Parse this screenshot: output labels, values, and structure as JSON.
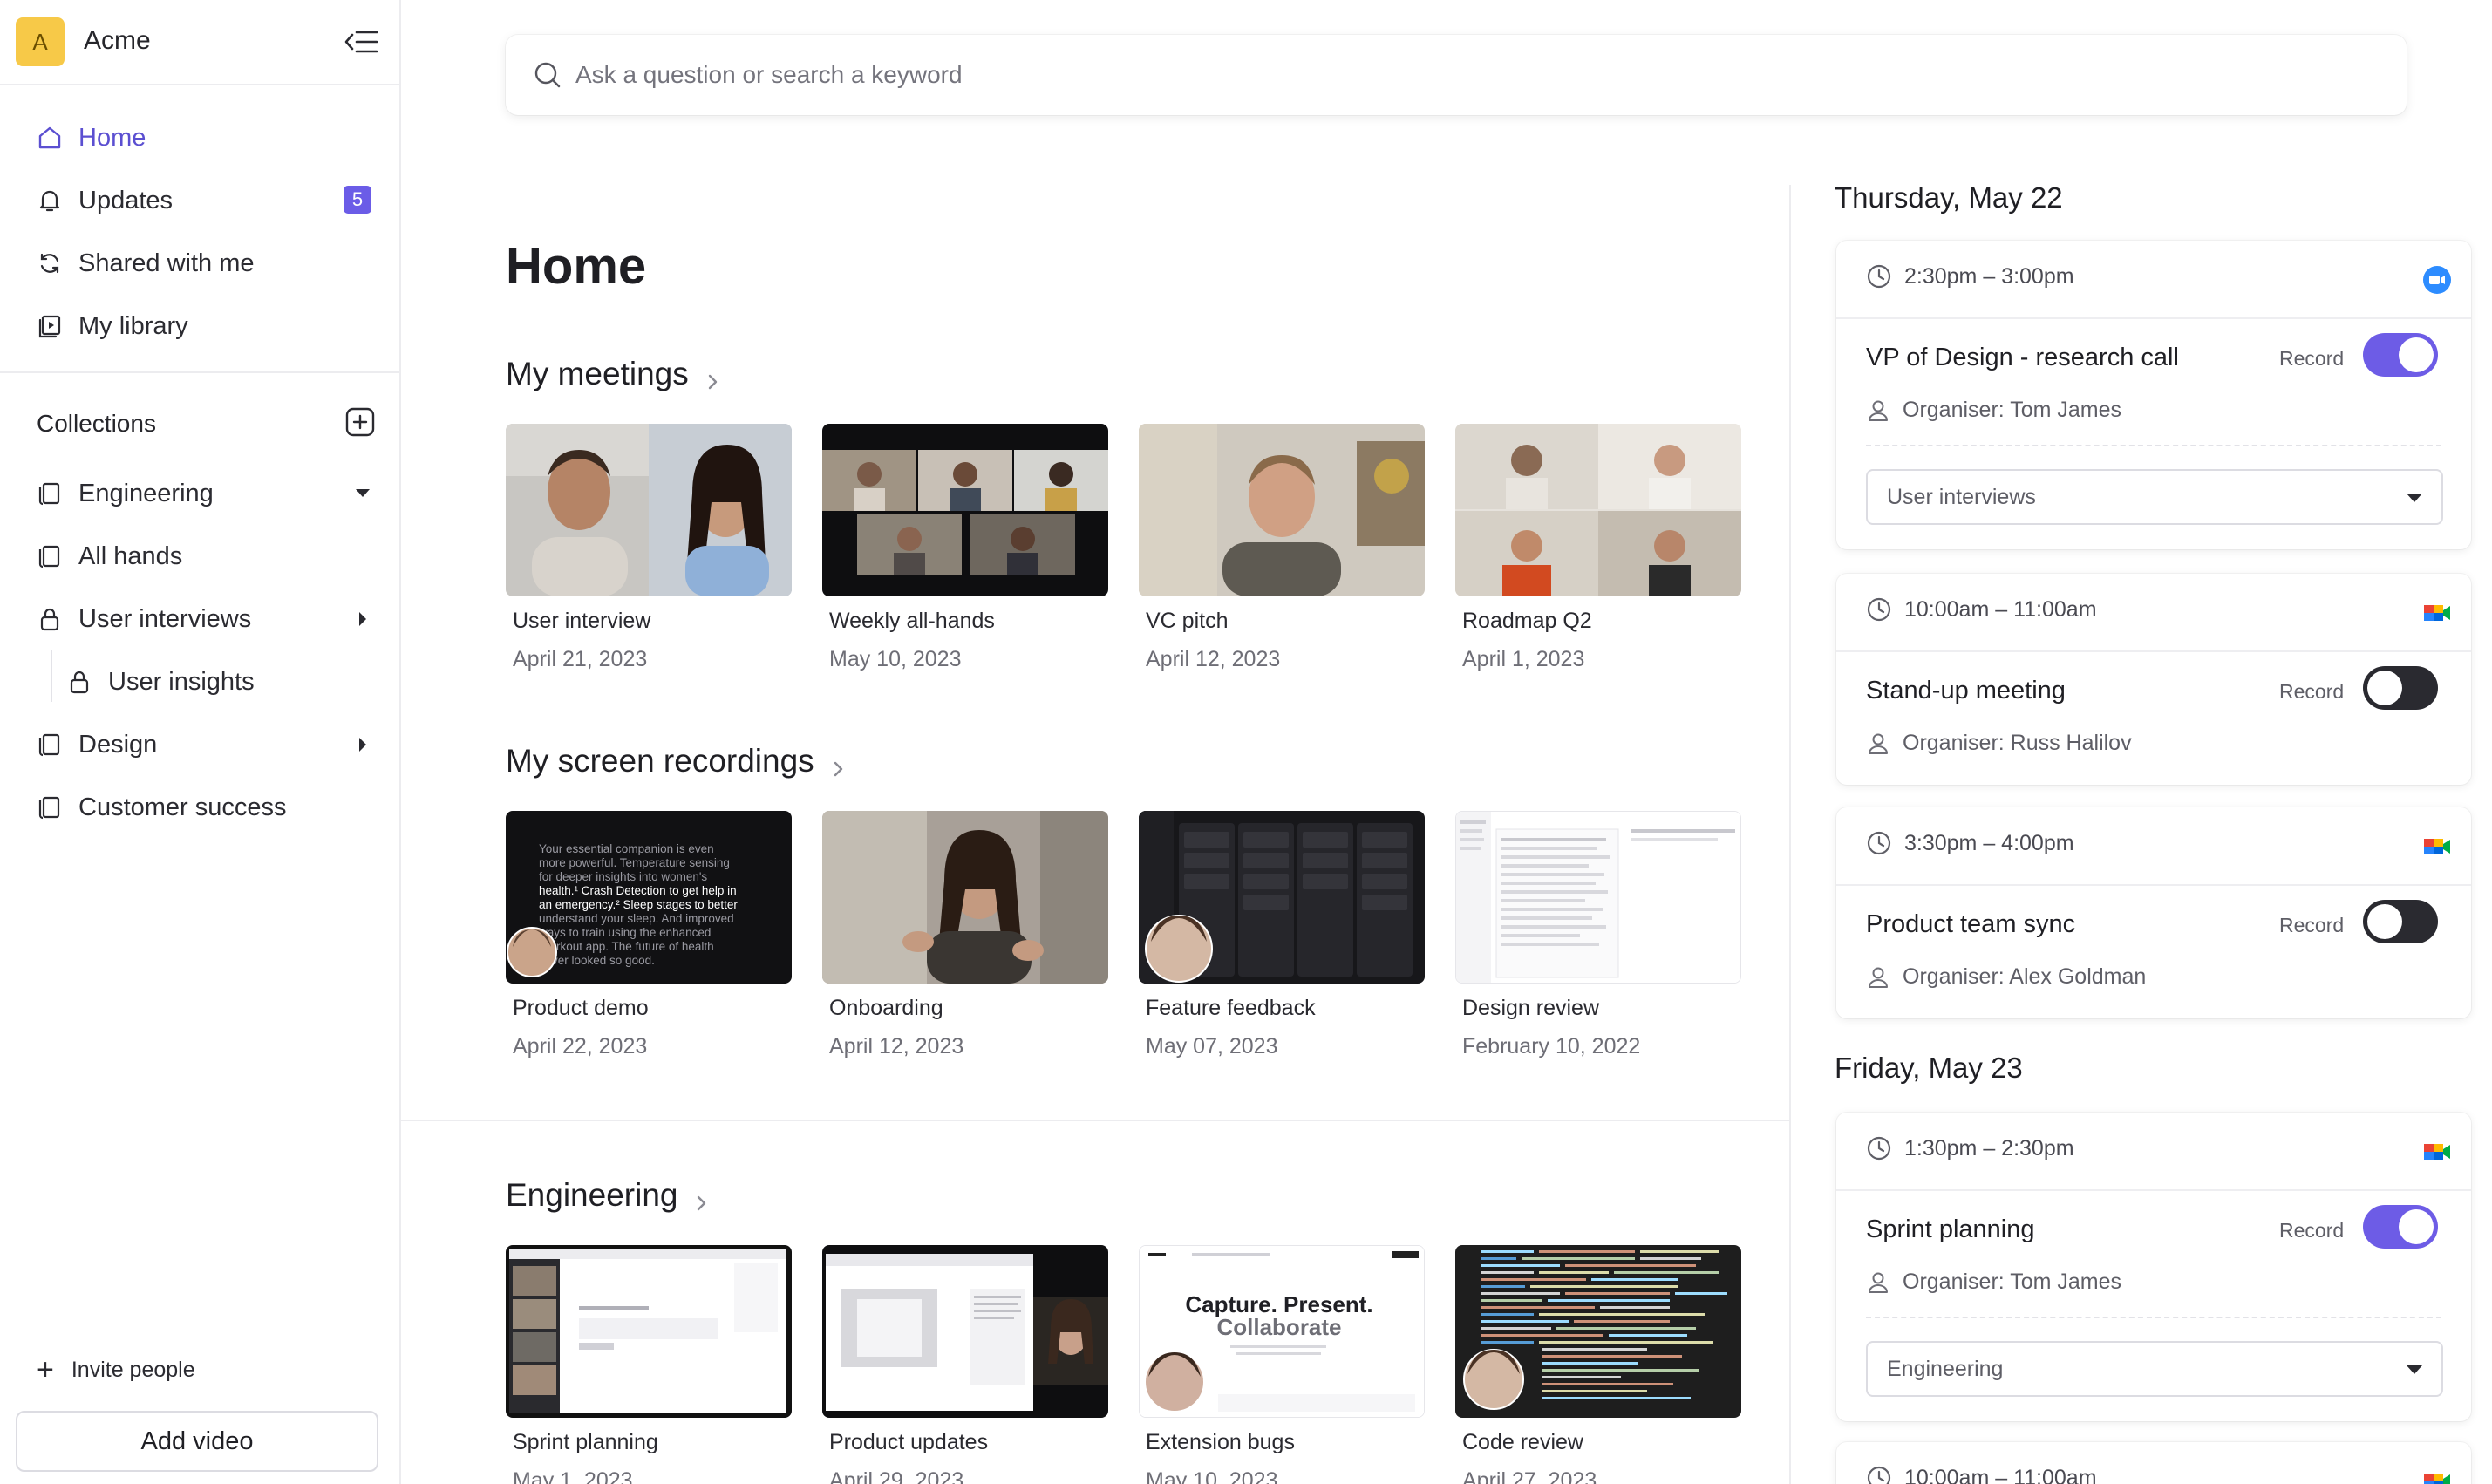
{
  "workspace": {
    "initial": "A",
    "name": "Acme"
  },
  "nav": [
    {
      "label": "Home",
      "icon": "home-icon"
    },
    {
      "label": "Updates",
      "icon": "bell-icon",
      "badge": "5"
    },
    {
      "label": "Shared with me",
      "icon": "sync-icon"
    },
    {
      "label": "My library",
      "icon": "library-icon"
    }
  ],
  "collections": {
    "title": "Collections",
    "items": [
      {
        "label": "Engineering",
        "icon": "folder-icon",
        "caret": "down"
      },
      {
        "label": "All hands",
        "icon": "folder-icon"
      },
      {
        "label": "User interviews",
        "icon": "lock-icon",
        "caret": "right"
      },
      {
        "label": "User insights",
        "icon": "lock-icon"
      },
      {
        "label": "Design",
        "icon": "folder-icon",
        "caret": "right"
      },
      {
        "label": "Customer success",
        "icon": "folder-icon"
      }
    ]
  },
  "sidebar_footer": {
    "invite": "Invite people",
    "add_video": "Add video"
  },
  "search": {
    "placeholder": "Ask a question or search a keyword"
  },
  "page": {
    "title": "Home"
  },
  "sections": [
    {
      "title": "My meetings",
      "cards": [
        {
          "title": "User interview",
          "date": "April 21, 2023"
        },
        {
          "title": "Weekly all-hands",
          "date": "May 10, 2023"
        },
        {
          "title": "VC pitch",
          "date": "April 12, 2023"
        },
        {
          "title": "Roadmap Q2",
          "date": "April 1, 2023"
        }
      ]
    },
    {
      "title": "My screen recordings",
      "cards": [
        {
          "title": "Product demo",
          "date": "April 22, 2023"
        },
        {
          "title": "Onboarding",
          "date": "April 12, 2023"
        },
        {
          "title": "Feature feedback",
          "date": "May 07, 2023"
        },
        {
          "title": "Design review",
          "date": "February 10, 2022"
        }
      ]
    },
    {
      "title": "Engineering",
      "cards": [
        {
          "title": "Sprint planning",
          "date": "May 1, 2023"
        },
        {
          "title": "Product updates",
          "date": "April 29, 2023"
        },
        {
          "title": "Extension bugs",
          "date": "May 10, 2023"
        },
        {
          "title": "Code review",
          "date": "April 27, 2023"
        }
      ]
    }
  ],
  "thumb_text": {
    "product_demo": [
      "Your essential companion is even",
      "more powerful. Temperature sensing",
      "for deeper insights into women's",
      "health.¹ Crash Detection to get help in",
      "an emergency.² Sleep stages to better",
      "understand your sleep. And improved",
      "ways to train using the enhanced",
      "Workout app. The future of health",
      "never looked so good."
    ],
    "extension_bugs": [
      "Capture. Present.",
      "Collaborate"
    ]
  },
  "calendar": {
    "days": [
      {
        "title": "Thursday, May 22",
        "events": [
          {
            "time": "2:30pm – 3:00pm",
            "app": "zoom-icon",
            "title": "VP of Design - research call",
            "record_label": "Record",
            "record_on": true,
            "organiser": "Organiser: Tom James",
            "collection": "User interviews"
          },
          {
            "time": "10:00am – 11:00am",
            "app": "google-meet-icon",
            "title": "Stand-up meeting",
            "record_label": "Record",
            "record_on": false,
            "organiser": "Organiser: Russ Halilov"
          },
          {
            "time": "3:30pm – 4:00pm",
            "app": "google-meet-icon",
            "title": "Product team sync",
            "record_label": "Record",
            "record_on": false,
            "organiser": "Organiser: Alex Goldman"
          }
        ]
      },
      {
        "title": "Friday, May 23",
        "events": [
          {
            "time": "1:30pm – 2:30pm",
            "app": "google-meet-icon",
            "title": "Sprint planning",
            "record_label": "Record",
            "record_on": true,
            "organiser": "Organiser: Tom James",
            "collection": "Engineering"
          },
          {
            "time": "10:00am – 11:00am",
            "app": "google-meet-icon"
          }
        ]
      }
    ]
  },
  "colors": {
    "accent": "#6d5ce6",
    "avatar_bg": "#f7c948",
    "toggle_off": "#2a2a30"
  }
}
